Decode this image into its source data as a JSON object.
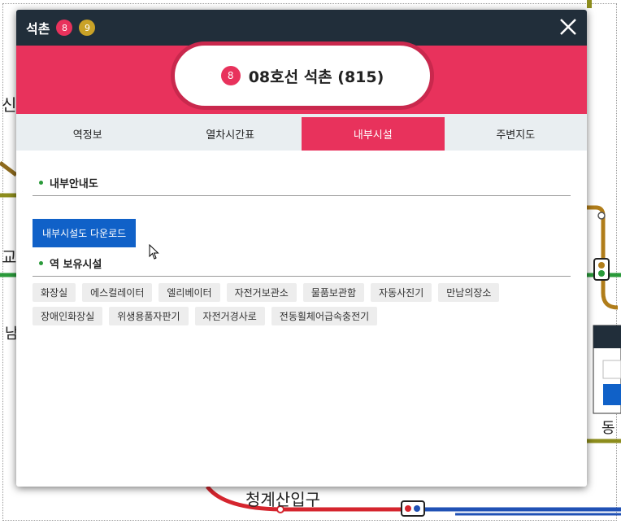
{
  "background_map": {
    "labels": [
      "청계산입구",
      "신",
      "교",
      "남",
      "동"
    ]
  },
  "popup": {
    "title": "석촌",
    "title_lines": [
      {
        "number": "8",
        "color": "#e8325c"
      },
      {
        "number": "9",
        "color": "#c9a227"
      }
    ],
    "close_label": "close",
    "station": {
      "line_number": "8",
      "line_color": "#e8325c",
      "name": "08호선 석촌 (815)"
    },
    "tabs": [
      {
        "label": "역정보",
        "active": false
      },
      {
        "label": "열차시간표",
        "active": false
      },
      {
        "label": "내부시설",
        "active": true
      },
      {
        "label": "주변지도",
        "active": false
      }
    ],
    "section_guide": "내부안내도",
    "download_label": "내부시설도 다운로드",
    "section_facilities": "역 보유시설",
    "facilities": [
      "화장실",
      "에스컬레이터",
      "엘리베이터",
      "자전거보관소",
      "물품보관함",
      "자동사진기",
      "만남의장소",
      "장애인화장실",
      "위생용품자판기",
      "자전거경사로",
      "전동휠체어급속충전기"
    ]
  },
  "colors": {
    "accent": "#e8325c",
    "titlebar": "#212e3a",
    "button": "#1061c8"
  }
}
